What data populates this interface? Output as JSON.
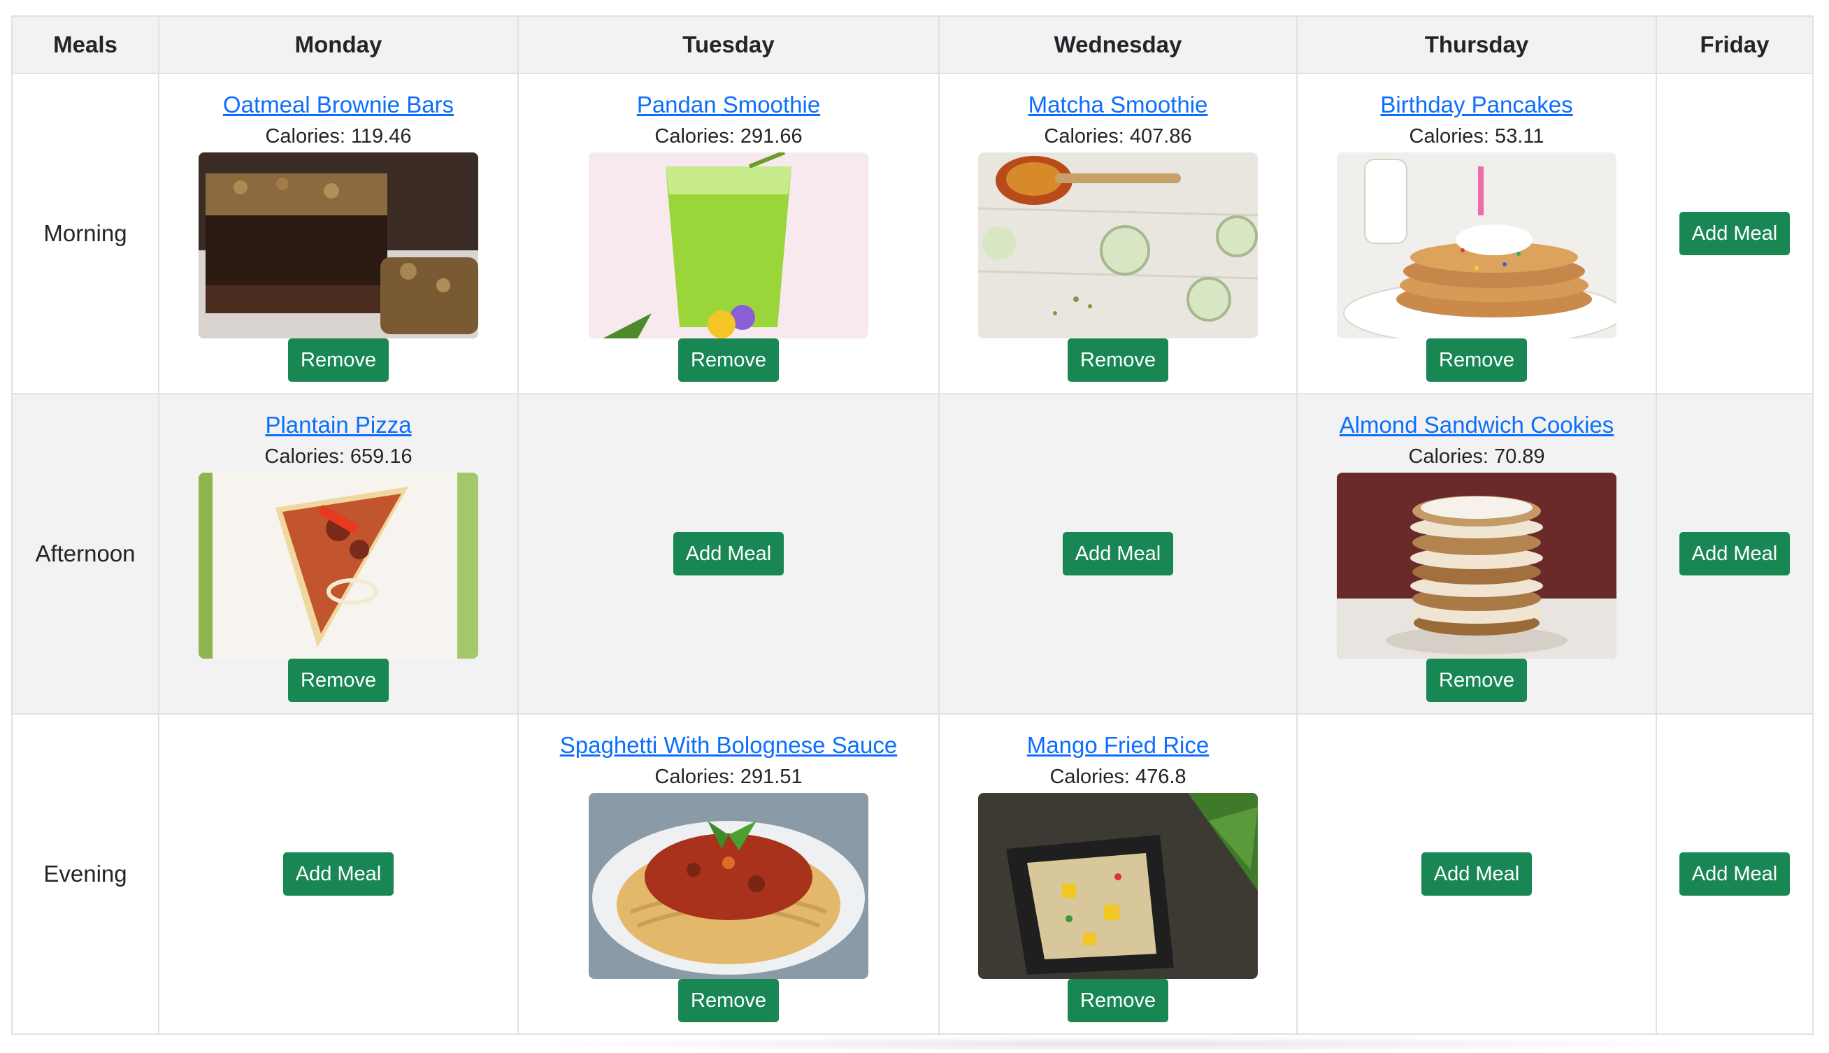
{
  "table": {
    "headers": [
      "Meals",
      "Monday",
      "Tuesday",
      "Wednesday",
      "Thursday",
      "Friday"
    ],
    "rows": [
      {
        "period": "Morning",
        "cells": [
          {
            "type": "meal",
            "name": "Oatmeal Brownie Bars",
            "calories": "Calories: 119.46",
            "image_icon": "brownie-bar-photo",
            "remove_label": "Remove"
          },
          {
            "type": "meal",
            "name": "Pandan Smoothie",
            "calories": "Calories: 291.66",
            "image_icon": "green-smoothie-photo",
            "remove_label": "Remove"
          },
          {
            "type": "meal",
            "name": "Matcha Smoothie",
            "calories": "Calories: 407.86",
            "image_icon": "matcha-smoothie-photo",
            "remove_label": "Remove"
          },
          {
            "type": "meal",
            "name": "Birthday Pancakes",
            "calories": "Calories: 53.11",
            "image_icon": "pancakes-photo",
            "remove_label": "Remove"
          },
          {
            "type": "empty",
            "add_label": "Add Meal"
          }
        ]
      },
      {
        "period": "Afternoon",
        "cells": [
          {
            "type": "meal",
            "name": "Plantain Pizza",
            "calories": "Calories: 659.16",
            "image_icon": "pizza-slice-photo",
            "remove_label": "Remove"
          },
          {
            "type": "empty",
            "add_label": "Add Meal"
          },
          {
            "type": "empty",
            "add_label": "Add Meal"
          },
          {
            "type": "meal",
            "name": "Almond Sandwich Cookies",
            "calories": "Calories: 70.89",
            "image_icon": "cookie-stack-photo",
            "remove_label": "Remove"
          },
          {
            "type": "empty",
            "add_label": "Add Meal"
          }
        ]
      },
      {
        "period": "Evening",
        "cells": [
          {
            "type": "empty",
            "add_label": "Add Meal"
          },
          {
            "type": "meal",
            "name": "Spaghetti With Bolognese Sauce",
            "calories": "Calories: 291.51",
            "image_icon": "spaghetti-photo",
            "remove_label": "Remove"
          },
          {
            "type": "meal",
            "name": "Mango Fried Rice",
            "calories": "Calories: 476.8",
            "image_icon": "fried-rice-photo",
            "remove_label": "Remove"
          },
          {
            "type": "empty",
            "add_label": "Add Meal"
          },
          {
            "type": "empty",
            "add_label": "Add Meal"
          }
        ]
      }
    ]
  },
  "colors": {
    "link": "#0d6efd",
    "button": "#198754",
    "header_bg": "#f2f2f2",
    "border": "#dee2e6"
  }
}
